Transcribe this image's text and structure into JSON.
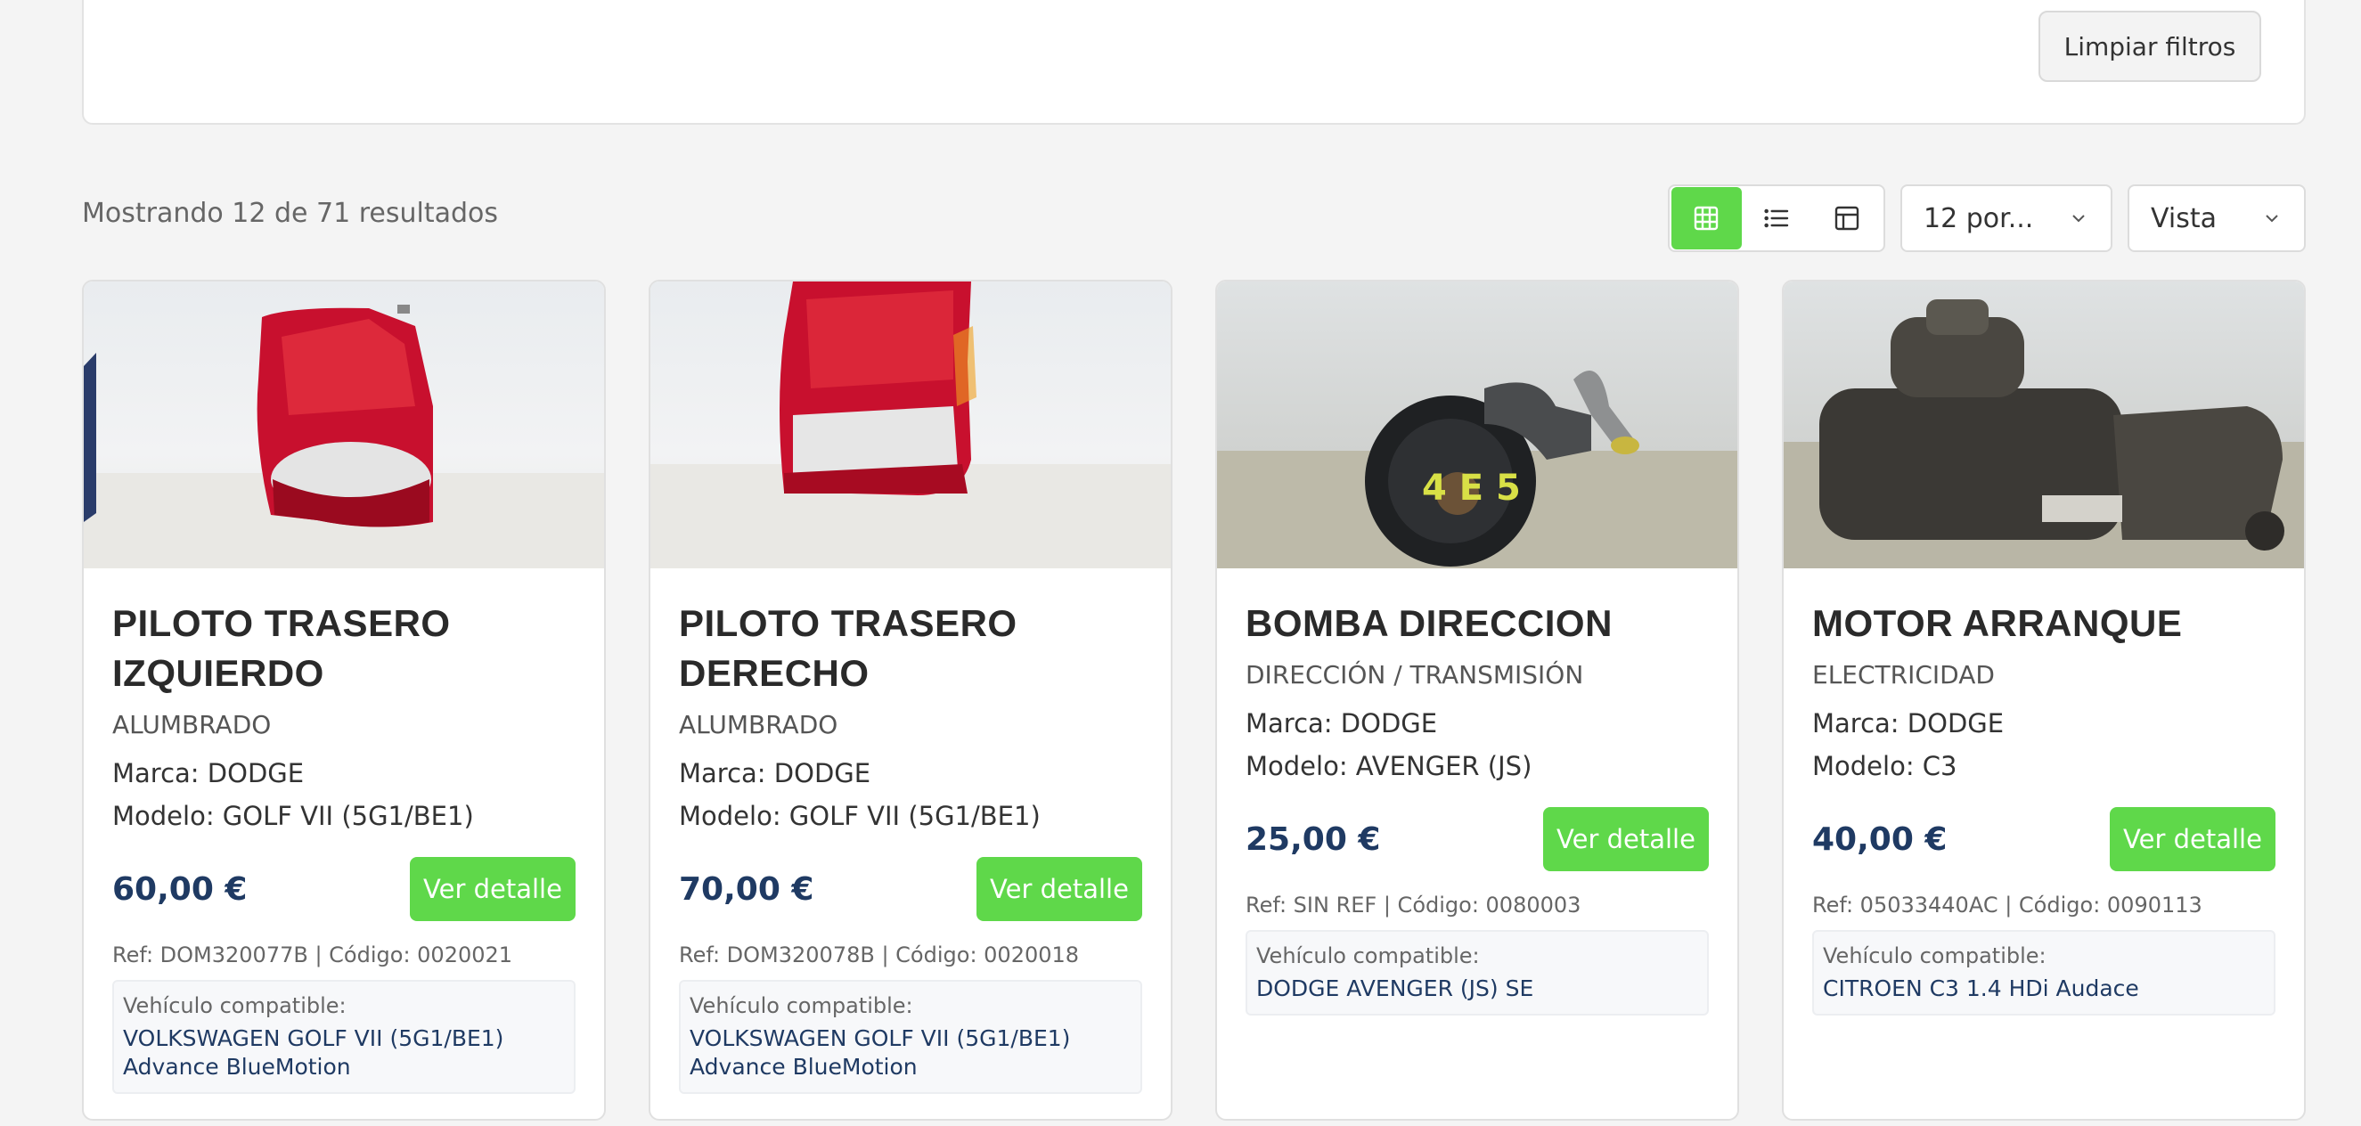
{
  "filters": {
    "clear_label": "Limpiar filtros"
  },
  "toolbar": {
    "results_text": "Mostrando 12 de 71 resultados",
    "per_page_value": "12 por...",
    "view_value": "Vista",
    "accent_color": "#5fd84a",
    "views": [
      {
        "icon": "grid-icon",
        "active": true
      },
      {
        "icon": "list-icon",
        "active": false
      },
      {
        "icon": "table-icon",
        "active": false
      }
    ]
  },
  "products": [
    {
      "title": "PILOTO TRASERO IZQUIERDO",
      "category": "ALUMBRADO",
      "brand": "Marca: DODGE",
      "model": "Modelo: GOLF VII (5G1/BE1)",
      "price": "60,00 €",
      "button": "Ver detalle",
      "ref": "Ref: DOM320077B | Código: 0020021",
      "compat_label": "Vehículo compatible:",
      "compat_vehicle": "VOLKSWAGEN GOLF VII (5G1/BE1) Advance BlueMotion"
    },
    {
      "title": "PILOTO TRASERO DERECHO",
      "category": "ALUMBRADO",
      "brand": "Marca: DODGE",
      "model": "Modelo: GOLF VII (5G1/BE1)",
      "price": "70,00 €",
      "button": "Ver detalle",
      "ref": "Ref: DOM320078B | Código: 0020018",
      "compat_label": "Vehículo compatible:",
      "compat_vehicle": "VOLKSWAGEN GOLF VII (5G1/BE1) Advance BlueMotion"
    },
    {
      "title": "BOMBA DIRECCION",
      "category": "DIRECCIÓN / TRANSMISIÓN",
      "brand": "Marca: DODGE",
      "model": "Modelo: AVENGER (JS)",
      "price": "25,00 €",
      "button": "Ver detalle",
      "ref": "Ref: SIN REF | Código: 0080003",
      "compat_label": "Vehículo compatible:",
      "compat_vehicle": "DODGE AVENGER (JS) SE"
    },
    {
      "title": "MOTOR ARRANQUE",
      "category": "ELECTRICIDAD",
      "brand": "Marca: DODGE",
      "model": "Modelo: C3",
      "price": "40,00 €",
      "button": "Ver detalle",
      "ref": "Ref: 05033440AC | Código: 0090113",
      "compat_label": "Vehículo compatible:",
      "compat_vehicle": "CITROEN C3 1.4 HDi Audace"
    }
  ]
}
